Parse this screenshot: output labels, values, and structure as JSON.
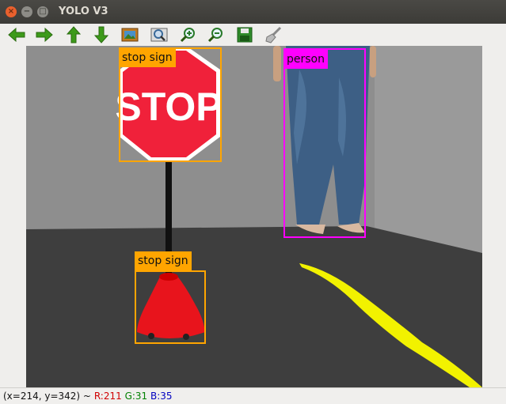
{
  "window": {
    "title": "YOLO V3"
  },
  "toolbar": {
    "icons": [
      "back-arrow-icon",
      "forward-arrow-icon",
      "up-arrow-icon",
      "down-arrow-icon",
      "image-icon",
      "zoom-fit-icon",
      "zoom-in-icon",
      "zoom-out-icon",
      "save-icon",
      "clear-brush-icon"
    ]
  },
  "detections": [
    {
      "label": "stop sign",
      "color": "#ffa500"
    },
    {
      "label": "person",
      "color": "#ff00ff"
    },
    {
      "label": "stop sign",
      "color": "#ffa500"
    }
  ],
  "status": {
    "coords": "(x=214, y=342) ~",
    "r": "R:211",
    "g": "G:31",
    "b": "B:35",
    "r_color": "#d00000",
    "g_color": "#008000",
    "b_color": "#0000c0"
  }
}
